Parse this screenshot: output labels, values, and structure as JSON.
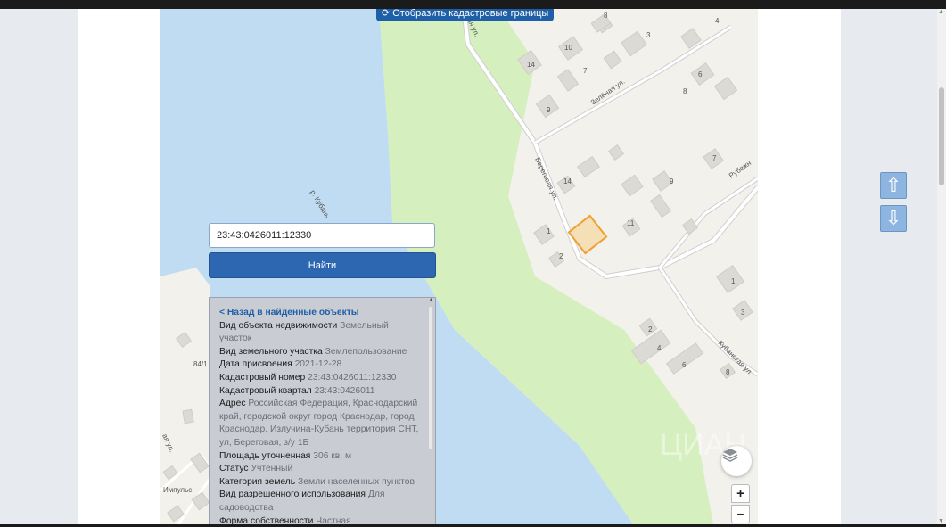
{
  "map": {
    "cadastral_button": "Отобразить кадастровые границы",
    "cadastral_icon": "refresh-icon",
    "streets": {
      "zelenaya": "Зелёная ул.",
      "beregovaya": "Береговая ул.",
      "rubezhnaya": "Рубежн",
      "kubanskaya": "Кубанская ул.",
      "river": "р. Кубань",
      "left_street": "ая ул.",
      "top_street": "ая ул."
    },
    "labels": {
      "impuls": "Импульс",
      "left_84": "84/1"
    },
    "house_numbers": [
      "8",
      "4",
      "10",
      "3",
      "14",
      "7",
      "6",
      "8",
      "9",
      "7",
      "14",
      "9",
      "11",
      "1",
      "2",
      "1",
      "3",
      "2",
      "4",
      "6",
      "8"
    ],
    "highlight_color": "#f0a030",
    "watermark": "ЦИАН"
  },
  "search": {
    "value": "23:43:0426011:12330",
    "find_label": "Найти"
  },
  "info": {
    "back_link": "< Назад в найденные объекты",
    "rows": [
      {
        "label": "Вид объекта недвижимости",
        "value": "Земельный участок"
      },
      {
        "label": "Вид земельного участка",
        "value": "Землепользование"
      },
      {
        "label": "Дата присвоения",
        "value": "2021-12-28"
      },
      {
        "label": "Кадастровый номер",
        "value": "23:43:0426011:12330"
      },
      {
        "label": "Кадастровый квартал",
        "value": "23:43:0426011"
      },
      {
        "label": "Адрес",
        "value": "Российская Федерация, Краснодарский край, городской округ город Краснодар, город Краснодар, Излучина-Кубань территория СНТ, ул, Береговая, з/у 1Б"
      },
      {
        "label": "Площадь уточненная",
        "value": "306 кв. м"
      },
      {
        "label": "Статус",
        "value": "Учтенный"
      },
      {
        "label": "Категория земель",
        "value": "Земли населенных пунктов"
      },
      {
        "label": "Вид разрешенного использования",
        "value": "Для садоводства"
      },
      {
        "label": "Форма собственности",
        "value": "Частная"
      }
    ]
  },
  "controls": {
    "zoom_in": "+",
    "zoom_out": "−",
    "layers_icon": "layers-icon",
    "zoom_right_label": "1"
  },
  "nav": {
    "up": "⇧",
    "down": "⇩"
  }
}
